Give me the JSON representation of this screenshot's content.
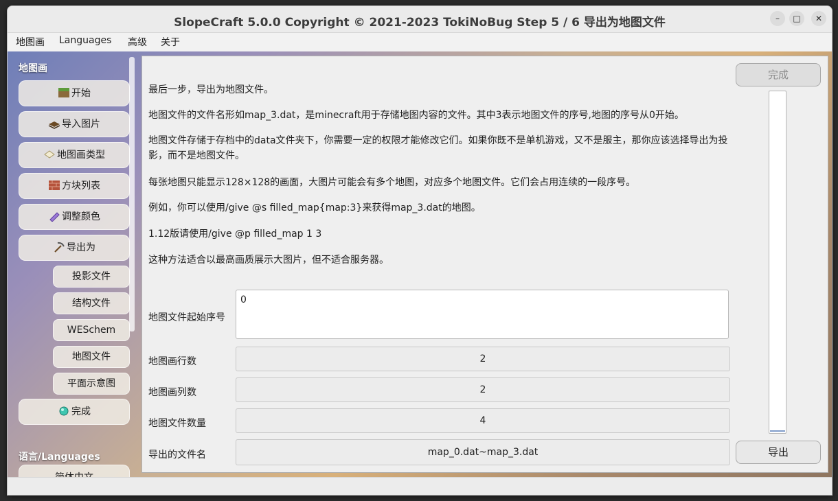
{
  "window": {
    "title": "SlopeCraft 5.0.0 Copyright © 2021-2023 TokiNoBug    Step 5 / 6   导出为地图文件",
    "minimize": "–",
    "maximize": "□",
    "close": "✕"
  },
  "menu": {
    "items": [
      "地图画",
      "Languages",
      "高级",
      "关于"
    ]
  },
  "sidebar": {
    "heading": "地图画",
    "items": [
      {
        "label": "开始",
        "icon": "grass-block-icon"
      },
      {
        "label": "导入图片",
        "icon": "book-icon"
      },
      {
        "label": "地图画类型",
        "icon": "paper-icon"
      },
      {
        "label": "方块列表",
        "icon": "brick-icon"
      },
      {
        "label": "调整颜色",
        "icon": "crystal-icon"
      },
      {
        "label": "导出为",
        "icon": "pickaxe-icon"
      }
    ],
    "subitems": [
      "投影文件",
      "结构文件",
      "WESchem",
      "地图文件",
      "平面示意图"
    ],
    "done": {
      "label": "完成",
      "icon": "diamond-icon"
    },
    "lang_heading": "语言/Languages",
    "lang_item": "简体中文"
  },
  "content": {
    "paragraphs": [
      "最后一步，导出为地图文件。",
      "地图文件的文件名形如map_3.dat，是minecraft用于存储地图内容的文件。其中3表示地图文件的序号,地图的序号从0开始。",
      "地图文件存储于存档中的data文件夹下，你需要一定的权限才能修改它们。如果你既不是单机游戏，又不是服主，那你应该选择导出为投影，而不是地图文件。",
      "每张地图只能显示128×128的画面，大图片可能会有多个地图，对应多个地图文件。它们会占用连续的一段序号。",
      "例如，你可以使用/give @s filled_map{map:3}来获得map_3.dat的地图。",
      "1.12版请使用/give @p filled_map 1 3",
      "这种方法适合以最高画质展示大图片，但不适合服务器。"
    ],
    "start_index": {
      "label": "地图文件起始序号",
      "value": "0"
    },
    "rows": {
      "label": "地图画行数",
      "value": "2"
    },
    "cols": {
      "label": "地图画列数",
      "value": "2"
    },
    "count": {
      "label": "地图文件数量",
      "value": "4"
    },
    "filename": {
      "label": "导出的文件名",
      "value": "map_0.dat~map_3.dat"
    }
  },
  "actions": {
    "done": "完成",
    "export": "导出"
  },
  "colors": {
    "accent": "#7f9cc9"
  }
}
